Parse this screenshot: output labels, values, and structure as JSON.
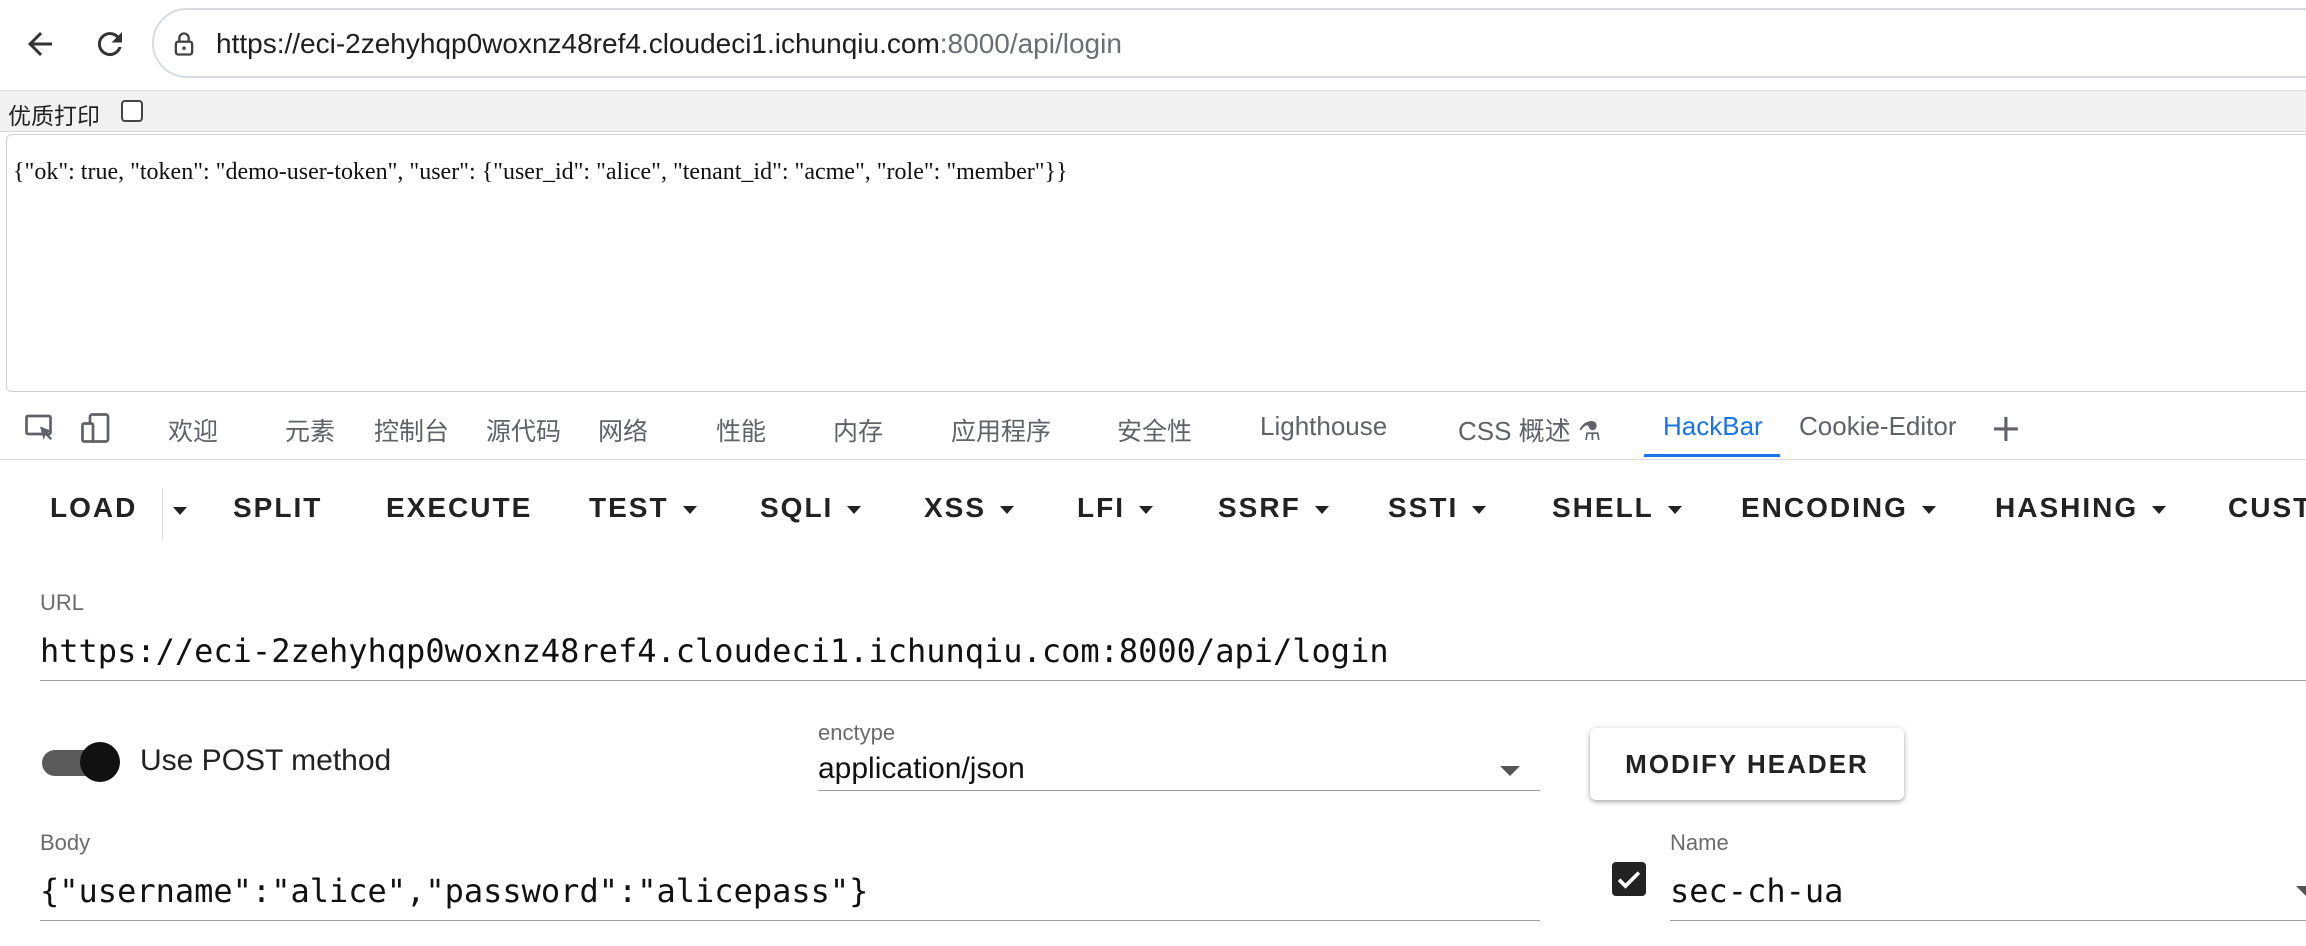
{
  "browser": {
    "url_host": "https://eci-2zehyhqp0woxnz48ref4.cloudeci1.ichunqiu.com",
    "url_path": ":8000/api/login"
  },
  "print_bar": {
    "label": "优质打印"
  },
  "response": {
    "text": "{\"ok\": true, \"token\": \"demo-user-token\", \"user\": {\"user_id\": \"alice\", \"tenant_id\": \"acme\", \"role\": \"member\"}}"
  },
  "devtools": {
    "tabs": [
      "欢迎",
      "元素",
      "控制台",
      "源代码",
      "网络",
      "性能",
      "内存",
      "应用程序",
      "安全性",
      "Lighthouse",
      "CSS 概述 ⚗",
      "HackBar",
      "Cookie-Editor"
    ],
    "active_tab": "HackBar"
  },
  "hackbar": {
    "toolbar": [
      "LOAD",
      "SPLIT",
      "EXECUTE",
      "TEST",
      "SQLI",
      "XSS",
      "LFI",
      "SSRF",
      "SSTI",
      "SHELL",
      "ENCODING",
      "HASHING",
      "CUST"
    ],
    "url_label": "URL",
    "url_value": "https://eci-2zehyhqp0woxnz48ref4.cloudeci1.ichunqiu.com:8000/api/login",
    "post_label": "Use POST method",
    "post_enabled": true,
    "enctype_label": "enctype",
    "enctype_value": "application/json",
    "modify_header_label": "MODIFY HEADER",
    "body_label": "Body",
    "body_value": "{\"username\":\"alice\",\"password\":\"alicepass\"}",
    "header_name_label": "Name",
    "header_name_value": "sec-ch-ua",
    "header_enabled": true
  },
  "colors": {
    "accent": "#1a73e8",
    "text": "#202124",
    "muted": "#5f6368"
  }
}
